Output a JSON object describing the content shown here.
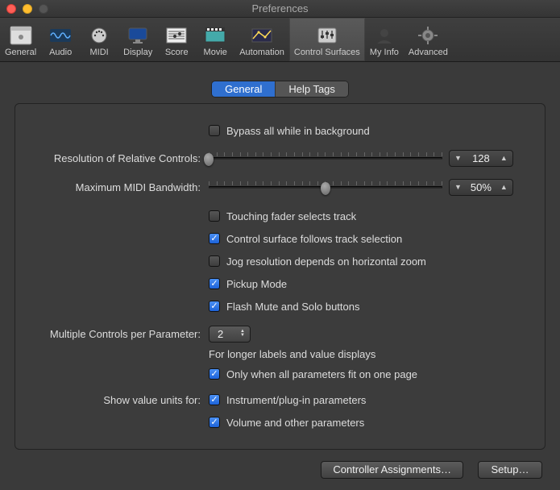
{
  "window": {
    "title": "Preferences"
  },
  "toolbar": {
    "items": [
      {
        "label": "General"
      },
      {
        "label": "Audio"
      },
      {
        "label": "MIDI"
      },
      {
        "label": "Display"
      },
      {
        "label": "Score"
      },
      {
        "label": "Movie"
      },
      {
        "label": "Automation"
      },
      {
        "label": "Control Surfaces"
      },
      {
        "label": "My Info"
      },
      {
        "label": "Advanced"
      }
    ],
    "selected": "Control Surfaces"
  },
  "subtabs": {
    "items": [
      {
        "label": "General"
      },
      {
        "label": "Help Tags"
      }
    ],
    "active": "General"
  },
  "settings": {
    "bypass_label": "Bypass all while in background",
    "bypass_checked": false,
    "resolution_label": "Resolution of Relative Controls:",
    "resolution_value": "128",
    "resolution_pos_pct": 0,
    "bandwidth_label": "Maximum MIDI Bandwidth:",
    "bandwidth_value": "50%",
    "bandwidth_pos_pct": 50,
    "touch_fader_label": "Touching fader selects track",
    "touch_fader_checked": false,
    "follows_selection_label": "Control surface follows track selection",
    "follows_selection_checked": true,
    "jog_label": "Jog resolution depends on horizontal zoom",
    "jog_checked": false,
    "pickup_label": "Pickup Mode",
    "pickup_checked": true,
    "flash_label": "Flash Mute and Solo buttons",
    "flash_checked": true,
    "multiple_label": "Multiple Controls per Parameter:",
    "multiple_value": "2",
    "multiple_helper": "For longer labels and value displays",
    "only_fit_label": "Only when all parameters fit on one page",
    "only_fit_checked": true,
    "show_units_label": "Show value units for:",
    "instrument_label": "Instrument/plug-in parameters",
    "instrument_checked": true,
    "volume_label": "Volume and other parameters",
    "volume_checked": true
  },
  "buttons": {
    "controller_assignments": "Controller Assignments…",
    "setup": "Setup…"
  }
}
